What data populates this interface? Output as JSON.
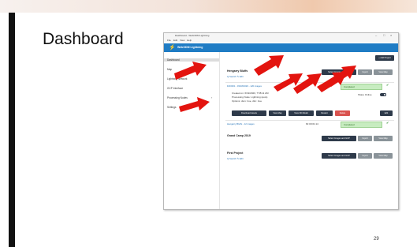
{
  "slide": {
    "title": "Dashboard",
    "page_number": "29"
  },
  "app": {
    "window_title": "Dashboard - WebODM Lightning",
    "menu": [
      "File",
      "Edit",
      "View",
      "Help"
    ],
    "header_title": "WebODM Lightning",
    "window_controls": [
      "–",
      "□",
      "×"
    ]
  },
  "sidebar": {
    "items": [
      {
        "label": "Dashboard"
      },
      {
        "label": "Map"
      },
      {
        "label": "Lightning Network"
      },
      {
        "label": "GCP Interface"
      },
      {
        "label": "Processing Nodes"
      },
      {
        "label": "Settings"
      }
    ]
  },
  "toolbar": {
    "add_project": "+ Add Project"
  },
  "projects": [
    {
      "name": "Hengarry Bluffs",
      "links": "Q Search  ✎ Edit",
      "actions": [
        "Select Images and GCP",
        "Import",
        "View Map"
      ]
    },
    {
      "name": "Grand Camp 2019",
      "actions": [
        "Select Images and GCP",
        "Import",
        "View Map"
      ]
    },
    {
      "name": "First Project",
      "links": "Q Search  ✎ Edit",
      "actions": [
        "Select Images and GCP",
        "Import",
        "View Map"
      ]
    }
  ],
  "tasks": [
    {
      "name": "DJI0001 - 03/18/2020 - 120 images",
      "status": "Completed",
      "created": "Created on: 6/19/2020, 7:58:11 AM",
      "node": "Processing Node: Lightning (auto)",
      "options": "Options: dsm: true, dtm: true",
      "share_label": "Share Online",
      "buttons": [
        "Download Assets",
        "View Map",
        "View 3D Model",
        "Restart",
        "Delete",
        "Edit"
      ]
    },
    {
      "name": "Hengarry Bluffs - 12 images",
      "meta": "60  00:01:14",
      "status": "Completed"
    }
  ]
}
